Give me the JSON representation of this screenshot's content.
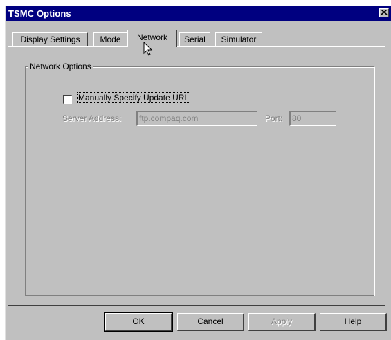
{
  "window": {
    "title": "TSMC Options"
  },
  "tabs": [
    {
      "label": "Display Settings"
    },
    {
      "label": "Mode"
    },
    {
      "label": "Network",
      "active": true
    },
    {
      "label": "Serial"
    },
    {
      "label": "Simulator"
    }
  ],
  "network": {
    "group_label": "Network Options",
    "manual_checkbox": {
      "label": "Manually Specify Update URL",
      "checked": false
    },
    "server_address": {
      "label": "Server Address:",
      "value": "ftp.compaq.com",
      "enabled": false
    },
    "port": {
      "label": "Port:",
      "value": "80",
      "enabled": false
    }
  },
  "buttons": {
    "ok": "OK",
    "cancel": "Cancel",
    "apply": "Apply",
    "help": "Help"
  },
  "colors": {
    "titlebar": "#000080",
    "face": "#c0c0c0",
    "disabled_text": "#808080"
  }
}
